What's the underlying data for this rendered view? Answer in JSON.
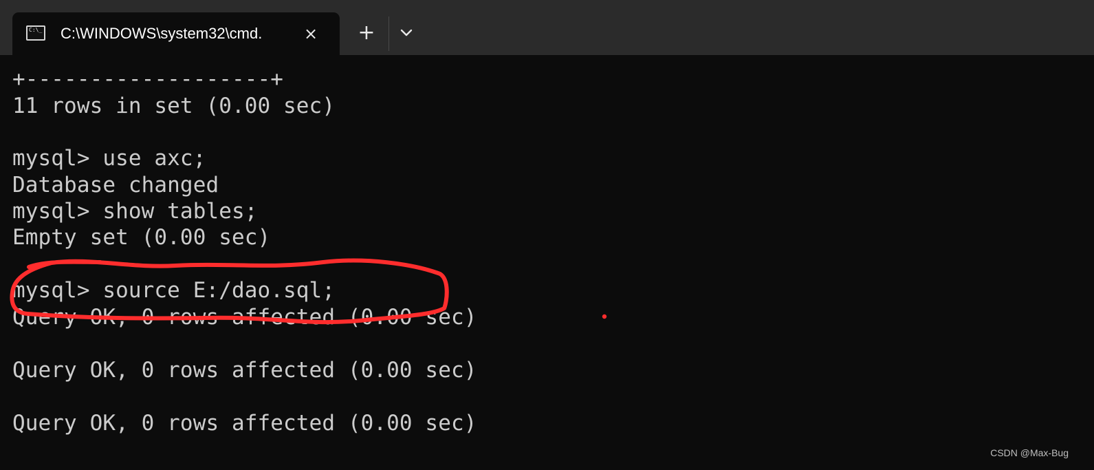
{
  "window": {
    "tab_title": "C:\\WINDOWS\\system32\\cmd.",
    "tab_icon": "terminal-icon",
    "tab_icon_text": "C:\\_",
    "close_icon": "close-icon",
    "new_tab_symbol": "+",
    "new_tab_icon": "plus-icon",
    "dropdown_icon": "chevron-down-icon"
  },
  "terminal": {
    "lines": [
      "+-------------------+",
      "11 rows in set (0.00 sec)",
      "",
      "mysql> use axc;",
      "Database changed",
      "mysql> show tables;",
      "Empty set (0.00 sec)",
      "",
      "mysql> source E:/dao.sql;",
      "Query OK, 0 rows affected (0.00 sec)",
      "",
      "Query OK, 0 rows affected (0.00 sec)",
      "",
      "Query OK, 0 rows affected (0.00 sec)"
    ]
  },
  "watermark": {
    "text": "CSDN @Max-Bug"
  },
  "colors": {
    "background": "#0c0c0c",
    "titlebar": "#2b2b2b",
    "text": "#cccccc",
    "annotation": "#ff2d2d"
  }
}
